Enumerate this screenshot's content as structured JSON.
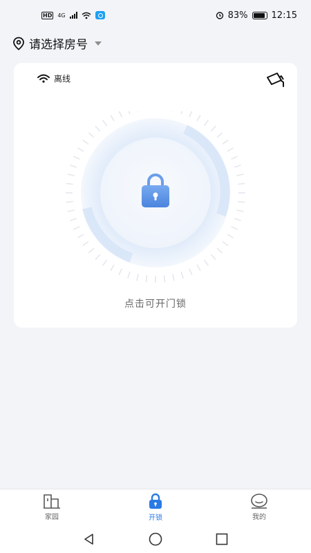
{
  "status_bar": {
    "hd": "HD",
    "network": "4G",
    "battery_percent": "83%",
    "time": "12:15",
    "battery_level": 0.83
  },
  "room_selector": {
    "label": "请选择房号"
  },
  "card": {
    "connection_status": "离线",
    "hint": "点击可开门锁"
  },
  "tabs": [
    {
      "label": "家园",
      "icon": "building-icon",
      "active": false
    },
    {
      "label": "开锁",
      "icon": "lock-icon",
      "active": true
    },
    {
      "label": "我的",
      "icon": "profile-icon",
      "active": false
    }
  ],
  "colors": {
    "accent": "#2a7ae4",
    "lock_blue": "#5b93e6",
    "background": "#f2f4f8"
  }
}
